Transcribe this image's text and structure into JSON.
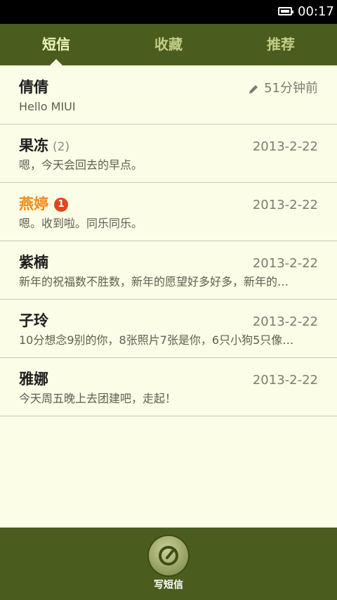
{
  "status_bar": {
    "time": "00:17"
  },
  "tabs": [
    {
      "label": "短信",
      "active": true
    },
    {
      "label": "收藏",
      "active": false
    },
    {
      "label": "推荐",
      "active": false
    }
  ],
  "conversations": [
    {
      "name": "倩倩",
      "preview": "Hello MIUI",
      "time": "51分钟前",
      "draft": true
    },
    {
      "name": "果冻",
      "count": "(2)",
      "preview": "嗯，今天会回去的早点。",
      "time": "2013-2-22"
    },
    {
      "name": "燕婷",
      "unread_badge": "1",
      "preview": "嗯。收到啦。同乐同乐。",
      "time": "2013-2-22",
      "unread": true
    },
    {
      "name": "紫楠",
      "preview": "新年的祝福数不胜数，新年的愿望好多好多，新年的…",
      "time": "2013-2-22"
    },
    {
      "name": "子玲",
      "preview": "10分想念9别的你，8张照片7张是你，6只小狗5只像…",
      "time": "2013-2-22"
    },
    {
      "name": "雅娜",
      "preview": "今天周五晚上去团建吧，走起！",
      "time": "2013-2-22"
    }
  ],
  "compose": {
    "label": "写短信"
  },
  "colors": {
    "bar": "#4a5d1e",
    "background": "#fbfde6",
    "unread_name": "#f08a17",
    "badge": "#e0481a"
  }
}
